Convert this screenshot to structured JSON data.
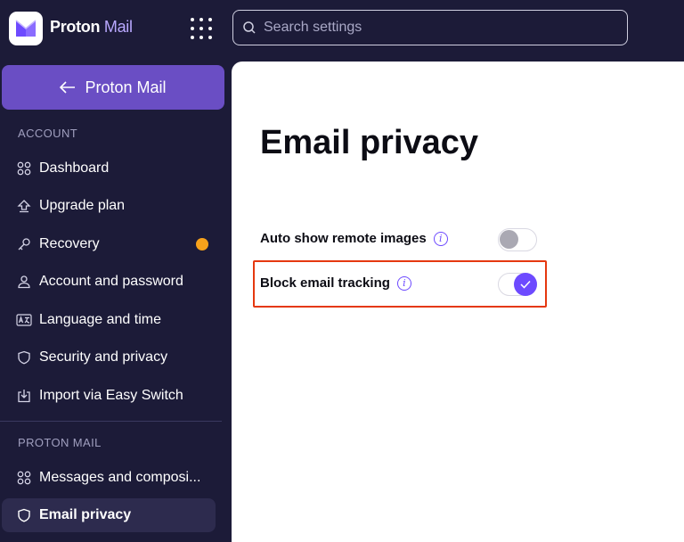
{
  "brand": {
    "name": "Proton",
    "product": "Mail"
  },
  "search": {
    "placeholder": "Search settings"
  },
  "sidebar": {
    "back_label": "Proton Mail",
    "sections": [
      {
        "label": "ACCOUNT",
        "items": [
          {
            "label": "Dashboard",
            "icon": "grid-icon"
          },
          {
            "label": "Upgrade plan",
            "icon": "upgrade-icon"
          },
          {
            "label": "Recovery",
            "icon": "key-icon",
            "badge_color": "#f7a21b"
          },
          {
            "label": "Account and password",
            "icon": "user-icon"
          },
          {
            "label": "Language and time",
            "icon": "language-icon"
          },
          {
            "label": "Security and privacy",
            "icon": "shield-icon"
          },
          {
            "label": "Import via Easy Switch",
            "icon": "import-icon"
          }
        ]
      },
      {
        "label": "PROTON MAIL",
        "items": [
          {
            "label": "Messages and composi...",
            "icon": "grid-icon"
          },
          {
            "label": "Email privacy",
            "icon": "shield-icon",
            "active": true
          }
        ]
      }
    ]
  },
  "main": {
    "title": "Email privacy",
    "settings": [
      {
        "label": "Auto show remote images",
        "enabled": false
      },
      {
        "label": "Block email tracking",
        "enabled": true
      }
    ]
  },
  "colors": {
    "sidebar_bg": "#1c1b38",
    "accent": "#6d4aff",
    "highlight": "#e5380f",
    "badge": "#f7a21b"
  }
}
